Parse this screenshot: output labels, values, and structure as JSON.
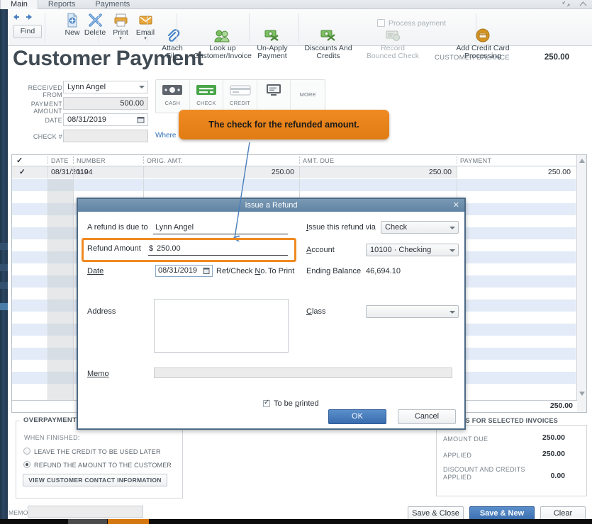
{
  "window": {
    "tabs": [
      {
        "label": "Main",
        "active": true
      },
      {
        "label": "Reports",
        "active": false
      },
      {
        "label": "Payments",
        "active": false
      }
    ],
    "restore_icon": "restore-icon",
    "minimize_icon": "chevron-up-icon"
  },
  "ribbon": {
    "back_icon": "back-arrow-icon",
    "forward_icon": "forward-arrow-icon",
    "find_label": "Find",
    "items": [
      {
        "label": "New",
        "icon": "new-document-icon",
        "disabled": false
      },
      {
        "label": "Delete",
        "icon": "delete-x-icon",
        "disabled": false
      },
      {
        "label": "Print",
        "icon": "printer-icon",
        "disabled": false,
        "dropdown": true
      },
      {
        "label": "Email",
        "icon": "envelope-icon",
        "disabled": false,
        "dropdown": true
      },
      {
        "label": "Attach\nFile",
        "icon": "paperclip-icon",
        "disabled": false
      },
      {
        "label": "Look up\nCustomer/Invoice",
        "icon": "people-lookup-icon",
        "disabled": false
      },
      {
        "label": "Un-Apply\nPayment",
        "icon": "money-unapply-icon",
        "disabled": false
      },
      {
        "label": "Discounts And\nCredits",
        "icon": "money-discount-icon",
        "disabled": false
      },
      {
        "label": "Record\nBounced Check",
        "icon": "bounced-check-icon",
        "disabled": true
      }
    ],
    "process_payment_label": "Process payment",
    "process_payment_checked": false,
    "add_credit_card": {
      "label": "Add Credit Card\nProcessing",
      "icon": "credit-card-circle-icon"
    }
  },
  "header": {
    "title": "Customer Payment",
    "customer_balance_label": "CUSTOMER BALANCE",
    "customer_balance_value": "250.00"
  },
  "form": {
    "received_from_label": "RECEIVED FROM",
    "received_from_value": "Lynn Angel",
    "payment_amount_label": "PAYMENT AMOUNT",
    "payment_amount_value": "500.00",
    "date_label": "DATE",
    "date_value": "08/31/2019",
    "check_no_label": "CHECK #",
    "check_no_value": "",
    "where_link": "Where",
    "payment_methods": [
      {
        "label": "CASH",
        "icon": "cash-icon",
        "selected": false
      },
      {
        "label": "CHECK",
        "icon": "check-icon",
        "selected": true
      },
      {
        "label": "CREDIT",
        "icon": "credit-card-icon",
        "selected": false
      },
      {
        "label": "",
        "icon": "e-check-monitor-icon",
        "selected": false
      },
      {
        "label": "MORE",
        "icon": "more-icon",
        "selected": false
      }
    ]
  },
  "table": {
    "columns": [
      "✓",
      "DATE",
      "NUMBER",
      "ORIG. AMT.",
      "AMT. DUE",
      "PAYMENT"
    ],
    "rows": [
      {
        "checked": true,
        "date": "08/31/2019",
        "number": "1104",
        "orig_amt": "250.00",
        "amt_due": "250.00",
        "payment": "250.00"
      }
    ],
    "footer_total": "250.00"
  },
  "overpayment": {
    "legend": "OVERPAYMENT",
    "when_finished_label": "WHEN FINISHED:",
    "options": [
      {
        "label": "LEAVE THE CREDIT TO BE USED LATER",
        "selected": false
      },
      {
        "label": "REFUND THE AMOUNT TO THE CUSTOMER",
        "selected": true
      }
    ],
    "view_contact_button": "VIEW CUSTOMER CONTACT INFORMATION"
  },
  "totals": {
    "legend": "TOTALS FOR SELECTED INVOICES",
    "rows": [
      {
        "label": "AMOUNT DUE",
        "value": "250.00"
      },
      {
        "label": "APPLIED",
        "value": "250.00"
      },
      {
        "label": "DISCOUNT AND CREDITS\nAPPLIED",
        "value": "0.00"
      }
    ]
  },
  "memo": {
    "label": "MEMO",
    "value": ""
  },
  "footer_buttons": [
    {
      "label": "Save & Close",
      "primary": false
    },
    {
      "label": "Save & New",
      "primary": true
    },
    {
      "label": "Clear",
      "primary": false
    }
  ],
  "modal": {
    "title": "Issue a Refund",
    "close_icon": "close-x-icon",
    "refund_due_to_label": "A refund is due to",
    "refund_due_to_value": "Lynn Angel",
    "refund_amount_label": "Refund Amount",
    "refund_amount_currency": "$",
    "refund_amount_value": "250.00",
    "date_label": "Date",
    "date_value": "08/31/2019",
    "ref_check_no_label": "Ref/Check No.",
    "ref_check_no_value": "To Print",
    "address_label": "Address",
    "address_value": "",
    "memo_label": "Memo",
    "memo_value": "",
    "issue_via_label": "Issue this refund via",
    "issue_via_value": "Check",
    "account_label": "Account",
    "account_value": "10100 · Checking",
    "ending_balance_label": "Ending Balance",
    "ending_balance_value": "46,694.10",
    "class_label": "Class",
    "class_value": "",
    "to_be_printed_label": "To be printed",
    "to_be_printed_checked": true,
    "ok_label": "OK",
    "cancel_label": "Cancel"
  },
  "annotation": {
    "callout_text": "The check for the refunded amount.",
    "callout_color": "#e98119",
    "highlight_color": "#ef8a22",
    "arrow_color": "#4a7ebb"
  }
}
